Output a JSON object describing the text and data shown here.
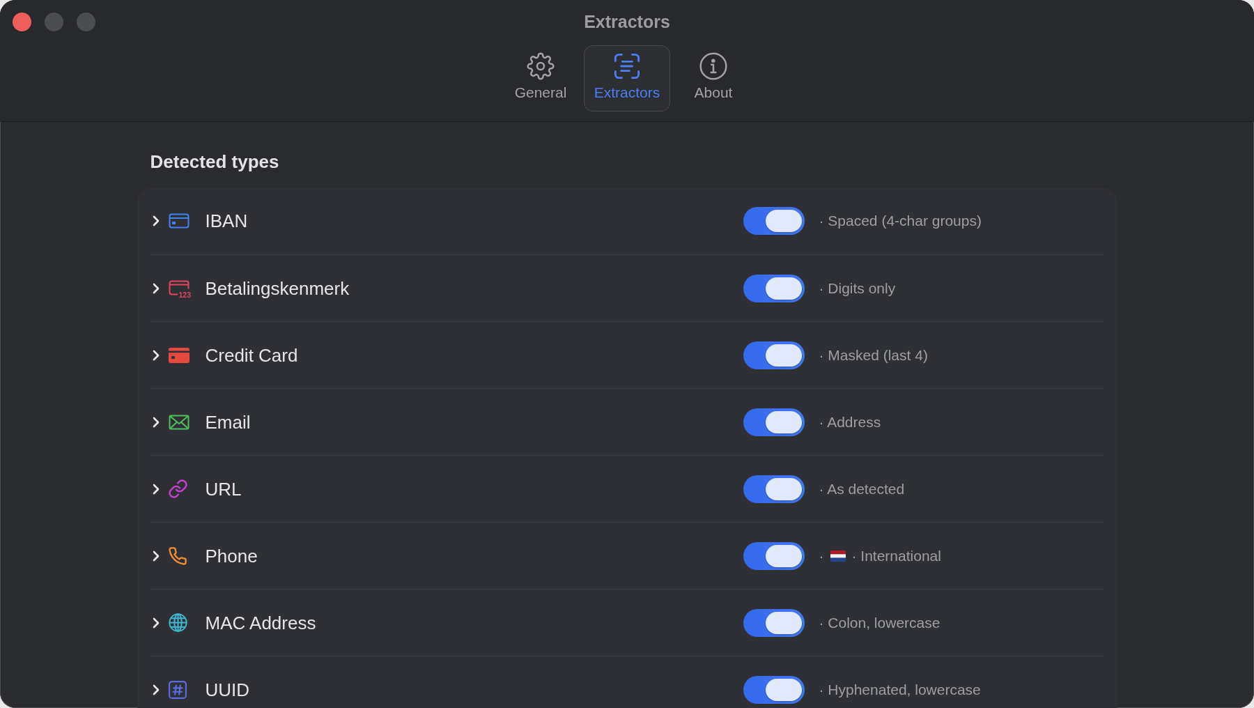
{
  "window": {
    "title": "Extractors",
    "controls": [
      {
        "disabled": false
      },
      {
        "disabled": true
      },
      {
        "disabled": true
      }
    ]
  },
  "tabs": [
    {
      "label": "General",
      "selected": false
    },
    {
      "label": "Extractors",
      "selected": true
    },
    {
      "label": "About",
      "selected": false
    }
  ],
  "section": {
    "heading": "Detected types"
  },
  "rows": [
    {
      "name": "IBAN",
      "color": "#3d85f5",
      "expanded": false,
      "on": true,
      "format": [
        {
          "kind": "text",
          "text": "· Spaced (4-char groups)"
        }
      ]
    },
    {
      "name": "Betalingskenmerk",
      "color": "#e5455e",
      "icon_text": "123",
      "expanded": false,
      "on": true,
      "format": [
        {
          "kind": "text",
          "text": "· Digits only"
        }
      ]
    },
    {
      "name": "Credit Card",
      "color": "#e8493f",
      "expanded": false,
      "on": true,
      "format": [
        {
          "kind": "text",
          "text": "· Masked (last 4)"
        }
      ]
    },
    {
      "name": "Email",
      "color": "#4dc15a",
      "expanded": false,
      "on": true,
      "format": [
        {
          "kind": "text",
          "text": "· Address"
        }
      ]
    },
    {
      "name": "URL",
      "color": "#c641d6",
      "expanded": false,
      "on": true,
      "format": [
        {
          "kind": "text",
          "text": "· As detected"
        }
      ]
    },
    {
      "name": "Phone",
      "color": "#ef9035",
      "expanded": false,
      "on": true,
      "format": [
        {
          "kind": "text",
          "text": "·"
        },
        {
          "kind": "flag"
        },
        {
          "kind": "text",
          "text": "· International"
        }
      ]
    },
    {
      "name": "MAC Address",
      "color": "#40b8cc",
      "expanded": false,
      "on": true,
      "format": [
        {
          "kind": "text",
          "text": "· Colon, lowercase"
        }
      ]
    },
    {
      "name": "UUID",
      "color": "#5c6be4",
      "expanded": false,
      "on": true,
      "format": [
        {
          "kind": "text",
          "text": "· Hyphenated, lowercase"
        }
      ]
    }
  ]
}
